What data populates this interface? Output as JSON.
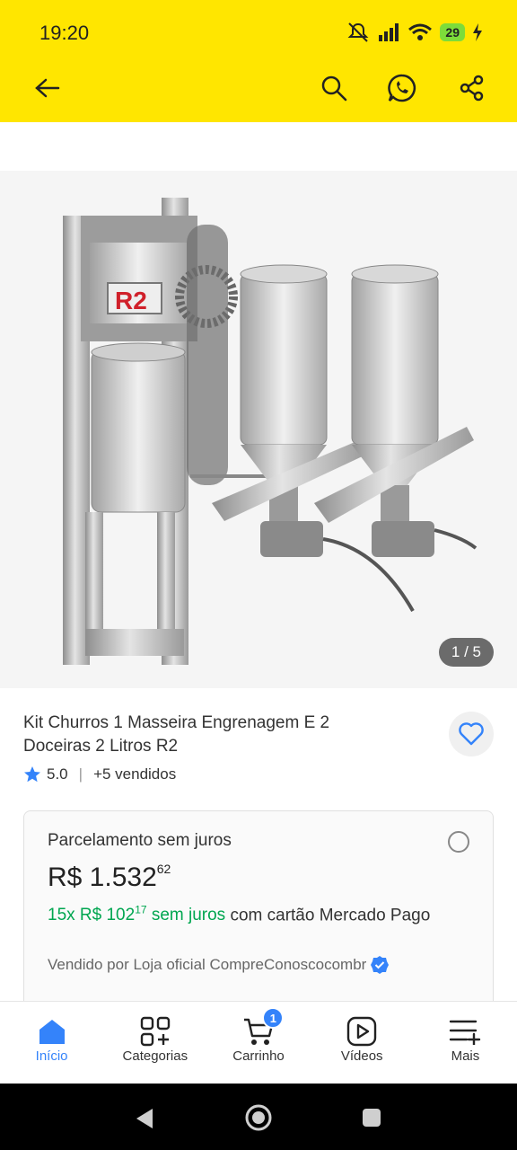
{
  "status_bar": {
    "time": "19:20",
    "battery": "29"
  },
  "app_bar": {
    "icons": [
      "back-arrow-icon",
      "search-icon",
      "whatsapp-icon",
      "share-icon"
    ]
  },
  "gallery": {
    "counter": "1 / 5",
    "logo_text": "R2",
    "current_index": 1,
    "total": 5
  },
  "product": {
    "title": "Kit Churros 1 Masseira Engrenagem E 2 Doceiras 2 Litros R2",
    "rating": "5.0",
    "sold": "+5 vendidos"
  },
  "payment_card": {
    "title": "Parcelamento sem juros",
    "price_main": "R$ 1.532",
    "price_cents": "62",
    "installment_count": "15x R$ 102",
    "installment_cents": "17",
    "installment_suffix": " sem juros",
    "installment_rest": " com cartão Mercado Pago",
    "seller": "Vendido por Loja oficial CompreConoscocombr"
  },
  "bottom_nav": {
    "items": [
      {
        "label": "Início",
        "icon": "home-icon"
      },
      {
        "label": "Categorias",
        "icon": "categories-icon"
      },
      {
        "label": "Carrinho",
        "icon": "cart-icon",
        "badge": "1"
      },
      {
        "label": "Vídeos",
        "icon": "video-icon"
      },
      {
        "label": "Mais",
        "icon": "menu-plus-icon"
      }
    ]
  },
  "colors": {
    "brand_yellow": "#ffe600",
    "accent_blue": "#3483fa",
    "green": "#00a650"
  }
}
